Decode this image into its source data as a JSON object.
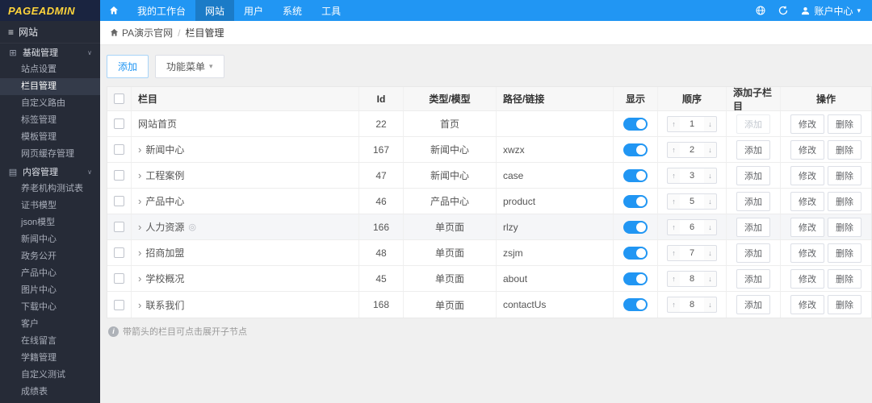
{
  "topbar": {
    "logo": "PAGEADMIN",
    "nav": [
      {
        "label": "我的工作台",
        "active": false
      },
      {
        "label": "网站",
        "active": true
      },
      {
        "label": "用户",
        "active": false
      },
      {
        "label": "系统",
        "active": false
      },
      {
        "label": "工具",
        "active": false
      }
    ],
    "account_label": "账户中心"
  },
  "sidebar": {
    "title": "网站",
    "groups": [
      {
        "label": "基础管理",
        "icon": "grid-icon",
        "items": [
          {
            "label": "站点设置",
            "active": false
          },
          {
            "label": "栏目管理",
            "active": true
          },
          {
            "label": "自定义路由",
            "active": false
          },
          {
            "label": "标签管理",
            "active": false
          },
          {
            "label": "模板管理",
            "active": false
          },
          {
            "label": "网页缓存管理",
            "active": false
          }
        ]
      },
      {
        "label": "内容管理",
        "icon": "document-icon",
        "items": [
          {
            "label": "养老机构测试表",
            "active": false
          },
          {
            "label": "证书模型",
            "active": false
          },
          {
            "label": "json模型",
            "active": false
          },
          {
            "label": "新闻中心",
            "active": false
          },
          {
            "label": "政务公开",
            "active": false
          },
          {
            "label": "产品中心",
            "active": false
          },
          {
            "label": "图片中心",
            "active": false
          },
          {
            "label": "下载中心",
            "active": false
          },
          {
            "label": "客户",
            "active": false
          },
          {
            "label": "在线留言",
            "active": false
          },
          {
            "label": "学籍管理",
            "active": false
          },
          {
            "label": "自定义测试",
            "active": false
          },
          {
            "label": "成绩表",
            "active": false
          }
        ]
      }
    ]
  },
  "breadcrumb": {
    "site": "PA演示官网",
    "separator": "/",
    "current": "栏目管理"
  },
  "toolbar": {
    "add_label": "添加",
    "menu_label": "功能菜单"
  },
  "table": {
    "headers": {
      "name": "栏目",
      "id": "Id",
      "type": "类型/模型",
      "path": "路径/链接",
      "show": "显示",
      "order": "顺序",
      "add_child": "添加子栏目",
      "ops": "操作"
    },
    "action_labels": {
      "add": "添加",
      "edit": "修改",
      "delete": "删除"
    },
    "rows": [
      {
        "name": "网站首页",
        "expandable": false,
        "hidden_icon": false,
        "id": "22",
        "type": "首页",
        "path": "",
        "show_on": true,
        "order": "1",
        "add_disabled": true,
        "dim": false
      },
      {
        "name": "新闻中心",
        "expandable": true,
        "hidden_icon": false,
        "id": "167",
        "type": "新闻中心",
        "path": "xwzx",
        "show_on": true,
        "order": "2",
        "add_disabled": false,
        "dim": false
      },
      {
        "name": "工程案例",
        "expandable": true,
        "hidden_icon": false,
        "id": "47",
        "type": "新闻中心",
        "path": "case",
        "show_on": true,
        "order": "3",
        "add_disabled": false,
        "dim": false
      },
      {
        "name": "产品中心",
        "expandable": true,
        "hidden_icon": false,
        "id": "46",
        "type": "产品中心",
        "path": "product",
        "show_on": true,
        "order": "5",
        "add_disabled": false,
        "dim": false
      },
      {
        "name": "人力资源",
        "expandable": true,
        "hidden_icon": true,
        "id": "166",
        "type": "单页面",
        "path": "rlzy",
        "show_on": true,
        "order": "6",
        "add_disabled": false,
        "dim": true
      },
      {
        "name": "招商加盟",
        "expandable": true,
        "hidden_icon": false,
        "id": "48",
        "type": "单页面",
        "path": "zsjm",
        "show_on": true,
        "order": "7",
        "add_disabled": false,
        "dim": false
      },
      {
        "name": "学校概况",
        "expandable": true,
        "hidden_icon": false,
        "id": "45",
        "type": "单页面",
        "path": "about",
        "show_on": true,
        "order": "8",
        "add_disabled": false,
        "dim": false
      },
      {
        "name": "联系我们",
        "expandable": true,
        "hidden_icon": false,
        "id": "168",
        "type": "单页面",
        "path": "contactUs",
        "show_on": true,
        "order": "8",
        "add_disabled": false,
        "dim": false
      }
    ]
  },
  "footnote": "带箭头的栏目可点击展开子节点",
  "colors": {
    "topbar": "#2196f3",
    "toggle_on": "#2196f3",
    "logo_text": "#ffd43b",
    "sidebar_bg": "#262b37"
  }
}
